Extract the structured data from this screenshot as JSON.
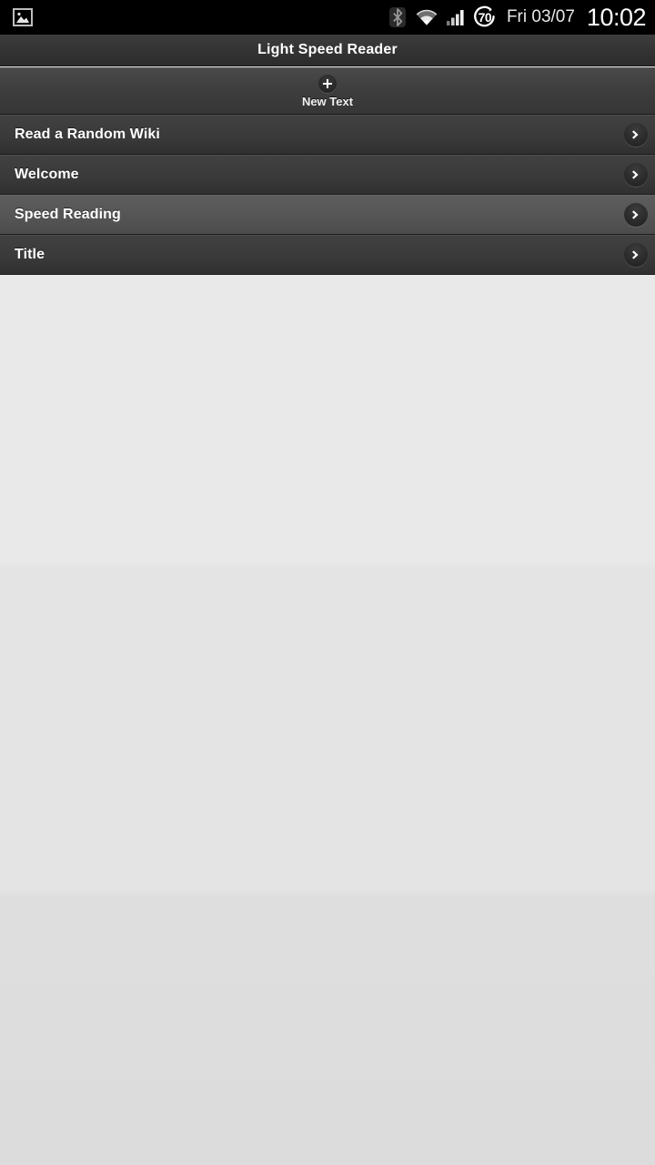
{
  "status_bar": {
    "notification_icon": "image-notification-icon",
    "bluetooth_icon": "bluetooth-icon",
    "wifi_icon": "wifi-icon",
    "signal_icon": "cellular-signal-icon",
    "battery_icon": "battery-circle-icon",
    "battery_level": "70",
    "date": "Fri 03/07",
    "clock": "10:02"
  },
  "title_bar": {
    "app_title": "Light Speed Reader"
  },
  "toolbar": {
    "new_text_label": "New Text",
    "plus_icon": "plus-icon"
  },
  "list": {
    "rows": [
      {
        "label": "Read a Random Wiki",
        "arrow_icon": "chevron-right-icon",
        "shade": "dark"
      },
      {
        "label": "Welcome",
        "arrow_icon": "chevron-right-icon",
        "shade": "dark"
      },
      {
        "label": "Speed Reading",
        "arrow_icon": "chevron-right-icon",
        "shade": "light"
      },
      {
        "label": "Title",
        "arrow_icon": "chevron-right-icon",
        "shade": "dark"
      }
    ]
  },
  "colors": {
    "status_bar_bg": "#000000",
    "title_bar_bg": "#343434",
    "toolbar_bg": "#3e3e3e",
    "row_dark": "#3a3a3a",
    "row_light": "#555555",
    "content_bg": "#e7e7e7",
    "text_primary": "#ffffff"
  }
}
